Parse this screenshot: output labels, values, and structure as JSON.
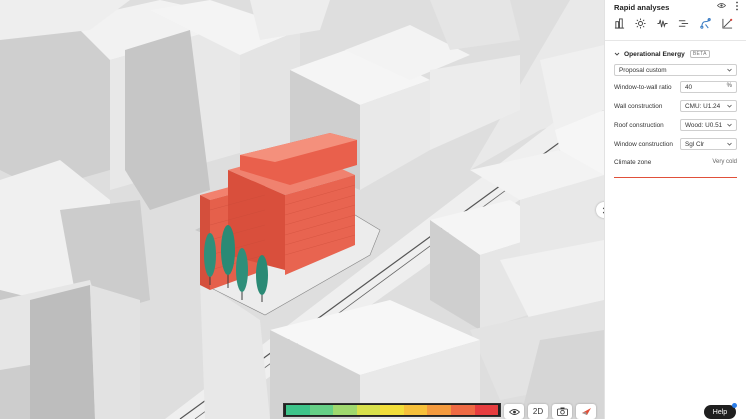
{
  "panel": {
    "title": "Rapid analyses",
    "tools": [
      "building-stats-icon",
      "sun-icon",
      "wind-icon",
      "flow-icon",
      "energy-icon",
      "area-icon"
    ],
    "section": {
      "title": "Operational Energy",
      "badge": "BETA",
      "scenario": "Proposal custom",
      "rows": [
        {
          "label": "Window-to-wall ratio",
          "value": "40",
          "unit": "%"
        },
        {
          "label": "Wall construction",
          "value": "CMU: U1.24"
        },
        {
          "label": "Roof construction",
          "value": "Wood: U0.51"
        },
        {
          "label": "Window construction",
          "value": "Sgl Clr"
        }
      ],
      "climate_label": "Climate zone",
      "climate_value": "Very cold"
    }
  },
  "controls": {
    "view_2d": "2D",
    "help": "Help"
  },
  "colors": {
    "accent": "#3a7cc4",
    "building": "#e8604c",
    "rule": "#e0503a"
  },
  "legend_colors": [
    "#3ec48a",
    "#66cf86",
    "#9fd86e",
    "#d7e04c",
    "#f2de3a",
    "#f6c03a",
    "#f39a3e",
    "#ee6a44",
    "#e63d3f"
  ]
}
